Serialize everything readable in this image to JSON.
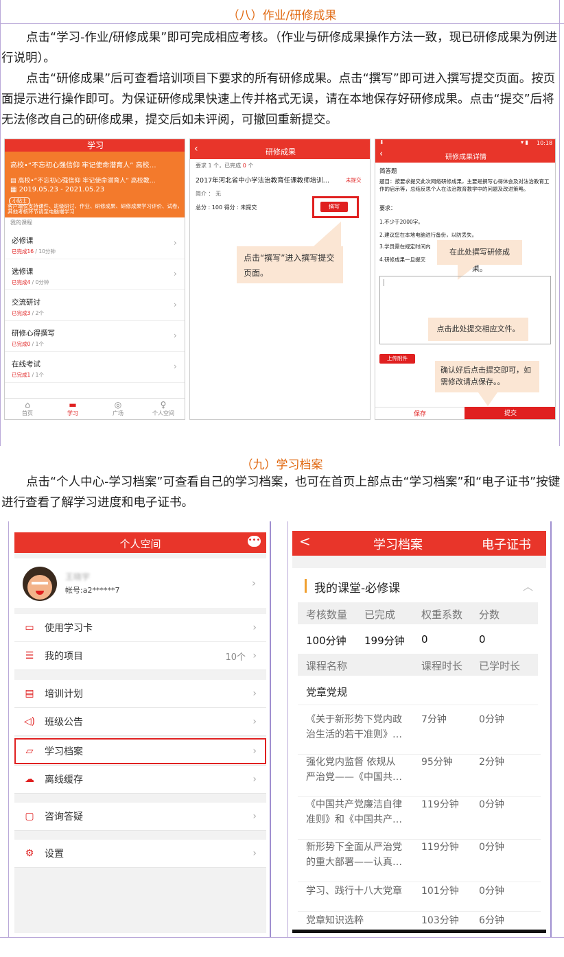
{
  "sec8": {
    "title": "（八）作业/研修成果",
    "p1": "点击“学习-作业/研修成果”即可完成相应考核。（作业与研修成果操作方法一致，现已研修成果为例进行说明）。",
    "p2": "点击“研修成果”后可查看培训项目下要求的所有研修成果。点击“撰写”即可进入撰写提交页面。按页面提示进行操作即可。为保证研修成果快速上传并格式无误，请在本地保存好研修成果。点击“提交”后将无法修改自己的研修成果，提交后如未评阅，可撤回重新提交。"
  },
  "s1": {
    "header": "学习",
    "banner_title": "高校•“不忘初心强信仰 牢记使命潜育人” 高校…",
    "banner_sub": "高校•“不忘初心强信仰 牢记使命潜育人” 高校教…",
    "date": "2019.05.23 - 2021.05.23",
    "badge": "小贴士",
    "tip": "客户端仅支持课件、班级研讨、作业、研修成果、研修成果学习评价、试卷，其他考核环节请至电脑端学习",
    "my_course": "我的课程",
    "items": [
      {
        "name": "必修课",
        "status": "已完成16",
        "extra": " / 10分钟"
      },
      {
        "name": "选修课",
        "status": "已完成4",
        "extra": " / 0分钟"
      },
      {
        "name": "交流研讨",
        "status": "已完成3",
        "extra": " / 2个"
      },
      {
        "name": "研修心得撰写",
        "status": "已完成0",
        "extra": " / 1个"
      },
      {
        "name": "在线考试",
        "status": "已完成1",
        "extra": " / 1个"
      }
    ],
    "tabs": [
      "首页",
      "学习",
      "广场",
      "个人空间"
    ]
  },
  "s2": {
    "header": "研修成果",
    "req_a": "要求 1 个，已完成 ",
    "req_b": "0",
    "req_c": " 个",
    "title": "2017年河北省中小学法治教育任课教师培训…",
    "status": "未提交",
    "intro": "简介 ： 无",
    "score": "总分 : 100    得分 : 未提交",
    "button": "撰写",
    "callout": "点击“撰写”进入撰写提交页面。"
  },
  "s3": {
    "time": "10:18",
    "header": "研修成果详情",
    "type": "简答题",
    "q": "题目：按要求提交此次网络研修成果，主要是撰写心得体会及对法治教育工作的启示等，总结反思个人在法治教育教学中的问题及改进策略。",
    "req": "要求：",
    "r1": "1.不少于2000字。",
    "r2": "2.建议您在本地电脑进行备份，以防丢失。",
    "r3": "3.学员需在规定时间内",
    "r4": "4.研修成果一旦提交",
    "callout1": "在此处撰写研修成果。",
    "callout2": "点击此处提交相应文件。",
    "upload": "上传附件",
    "callout3": "确认好后点击提交即可，如需修改请点保存。。",
    "save": "保存",
    "submit": "提交"
  },
  "sec9": {
    "title": "（九）学习档案",
    "p1": "点击“个人中心-学习档案”可查看自己的学习档案，也可在首页上部点击“学习档案”和“电子证书”按键进行查看了解学习进度和电子证书。"
  },
  "s4": {
    "header": "个人空间",
    "user_name": "王晓宇",
    "account": "帐号:a2******7",
    "items": [
      {
        "label": "使用学习卡",
        "icon": "card-icon"
      },
      {
        "label": "我的项目",
        "icon": "project-icon",
        "extra": "10个"
      },
      {
        "label": "培训计划",
        "icon": "calendar-icon"
      },
      {
        "label": "班级公告",
        "icon": "speaker-icon"
      },
      {
        "label": "学习档案",
        "icon": "folder-icon"
      },
      {
        "label": "离线缓存",
        "icon": "cloud-download-icon"
      },
      {
        "label": "咨询答疑",
        "icon": "chat-icon"
      },
      {
        "label": "设置",
        "icon": "gear-icon"
      }
    ]
  },
  "s5": {
    "back": "<",
    "title": "学习档案",
    "cert": "电子证书",
    "section": "我的课堂-必修课",
    "head": [
      "考核数量",
      "已完成",
      "权重系数",
      "分数"
    ],
    "vals": [
      "100分钟",
      "199分钟",
      "0",
      "0"
    ],
    "chead": [
      "课程名称",
      "课程时长",
      "已学时长"
    ],
    "group": "党章党规",
    "courses": [
      {
        "n1": "《关于新形势下党内政",
        "n2": "治生活的若干准则》…",
        "d": "7分钟",
        "l": "0分钟"
      },
      {
        "n1": "强化党内监督 依规从",
        "n2": "严治党——《中国共…",
        "d": "95分钟",
        "l": "2分钟"
      },
      {
        "n1": "《中国共产党廉洁自律",
        "n2": "准则》和《中国共产…",
        "d": "119分钟",
        "l": "0分钟"
      },
      {
        "n1": "新形势下全面从严治党",
        "n2": "的重大部署——认真…",
        "d": "119分钟",
        "l": "0分钟"
      },
      {
        "n1": "学习、践行十八大党章",
        "n2": "",
        "d": "101分钟",
        "l": "0分钟"
      },
      {
        "n1": "党章知识选粹",
        "n2": "",
        "d": "103分钟",
        "l": "6分钟"
      }
    ]
  },
  "colors": {
    "accent": "#e02020",
    "orange": "#e06810",
    "banner": "#f37a2c"
  }
}
